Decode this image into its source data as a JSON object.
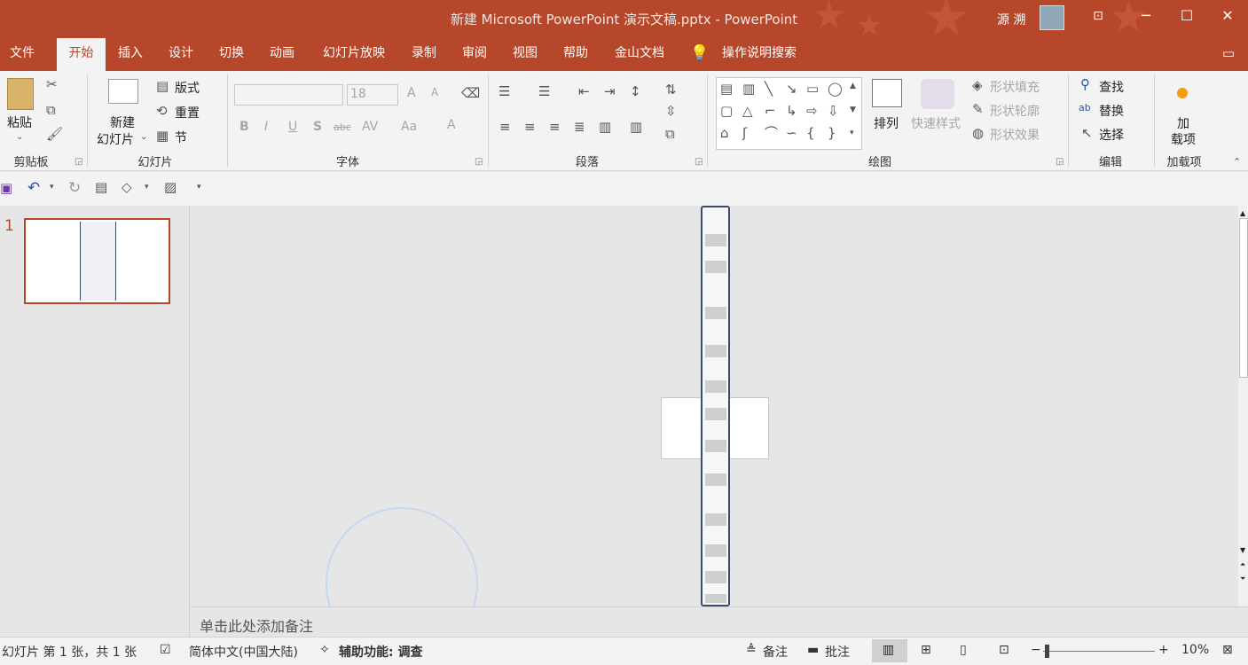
{
  "app": {
    "title": "新建 Microsoft PowerPoint 演示文稿.pptx  -  PowerPoint",
    "user": "源 溯",
    "accent": "#b7472a"
  },
  "window": {
    "restore_icon": "ribbon-display-icon",
    "minimize": "─",
    "maximize": "☐",
    "close": "✕"
  },
  "tabs": [
    "文件",
    "开始",
    "插入",
    "设计",
    "切换",
    "动画",
    "幻灯片放映",
    "录制",
    "审阅",
    "视图",
    "帮助",
    "金山文档",
    "操作说明搜索"
  ],
  "active_tab": "开始",
  "ribbon": {
    "clipboard": {
      "paste": "粘贴",
      "label": "剪贴板"
    },
    "slides": {
      "new_slide_line1": "新建",
      "new_slide_line2": "幻灯片",
      "layout": "版式",
      "reset": "重置",
      "section": "节",
      "label": "幻灯片"
    },
    "font": {
      "font_size": "18",
      "label": "字体",
      "bold": "B",
      "italic": "I",
      "underline": "U",
      "shadow": "S",
      "strike": "abc",
      "spacing": "AV",
      "case": "Aa",
      "grow": "A",
      "shrink": "A"
    },
    "paragraph": {
      "label": "段落"
    },
    "drawing": {
      "arrange": "排列",
      "quick_styles": "快速样式",
      "fill": "形状填充",
      "outline": "形状轮廓",
      "effects": "形状效果",
      "label": "绘图"
    },
    "editing": {
      "find": "查找",
      "replace": "替换",
      "select": "选择",
      "label": "编辑"
    },
    "addins": {
      "line1": "加",
      "line2": "载项",
      "label": "加载项"
    }
  },
  "slide_panel": {
    "slide_number": "1"
  },
  "notes": {
    "placeholder": "单击此处添加备注"
  },
  "statusbar": {
    "slide_info": "幻灯片 第 1 张，共 1 张",
    "language": "简体中文(中国大陆)",
    "accessibility": "辅助功能: 调查",
    "notes": "备注",
    "comments": "批注",
    "zoom": "10%"
  }
}
